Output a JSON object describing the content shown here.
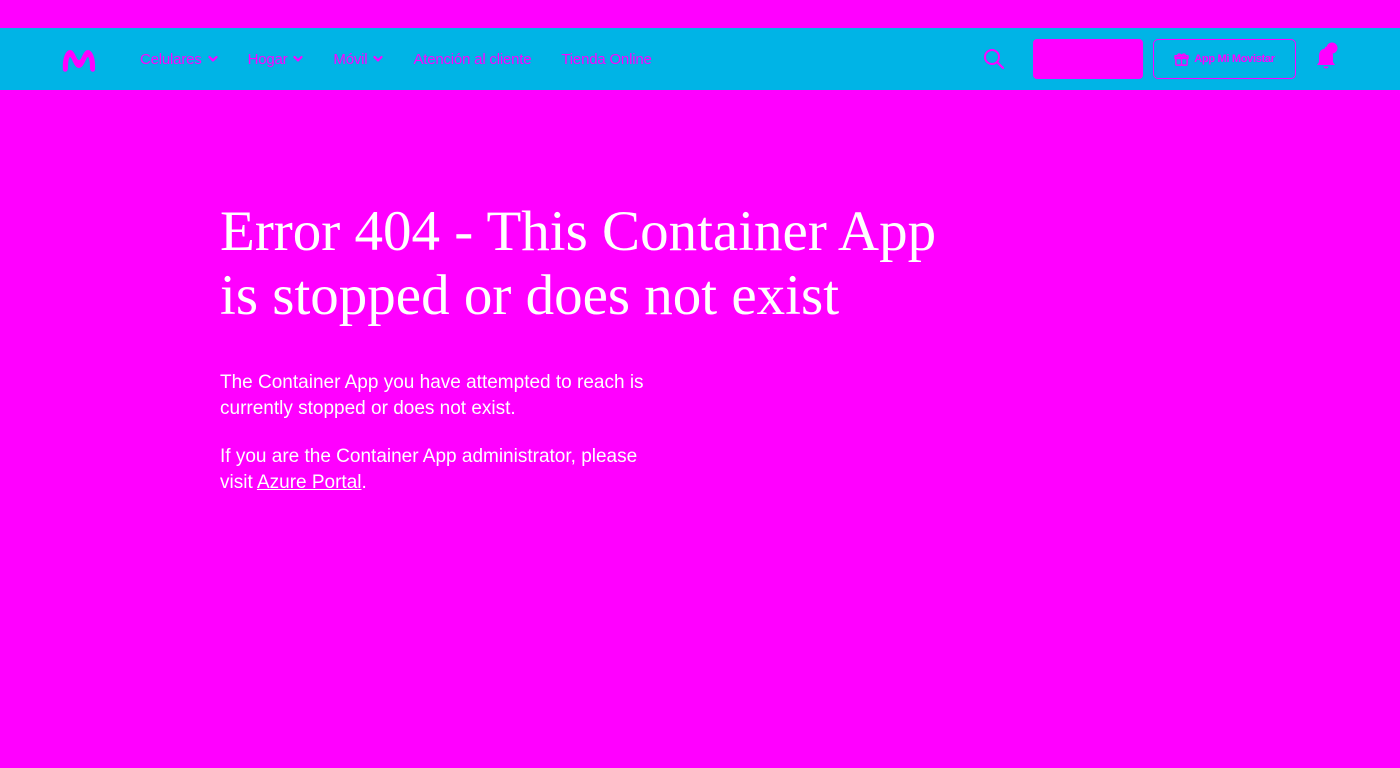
{
  "header": {
    "logo_name": "movistar-logo",
    "nav": [
      {
        "label": "Celulares",
        "has_dropdown": true
      },
      {
        "label": "Hogar",
        "has_dropdown": true
      },
      {
        "label": "Móvil",
        "has_dropdown": true
      },
      {
        "label": "Atención al cliente",
        "has_dropdown": false
      },
      {
        "label": "Tienda Online",
        "has_dropdown": false
      }
    ],
    "search_icon": "search-icon",
    "primary_button_label": "",
    "app_button_label": "App Mi Movistar",
    "app_button_icon": "gift-icon",
    "notification_icon": "bell-icon"
  },
  "main": {
    "title": "Error 404 - This Container App is stopped or does not exist",
    "paragraph1": "The Container App you have attempted to reach is currently stopped or does not exist.",
    "paragraph2_prefix": "If you are the Container App administrator, please visit ",
    "paragraph2_link": "Azure Portal",
    "paragraph2_suffix": "."
  },
  "colors": {
    "background": "#ff00ff",
    "navbar": "#00b4e6",
    "accent": "#ff00ff",
    "text": "#ffffff"
  }
}
